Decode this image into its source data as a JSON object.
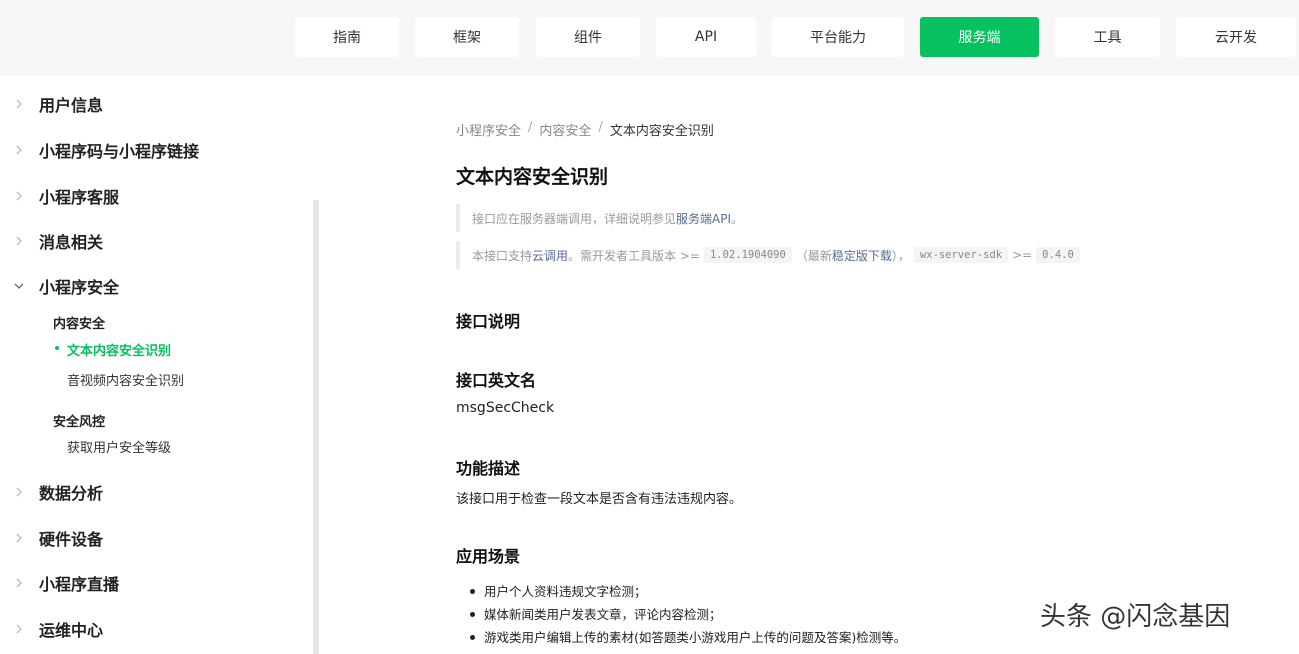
{
  "topnav": {
    "tabs": [
      {
        "label": "指南"
      },
      {
        "label": "框架"
      },
      {
        "label": "组件"
      },
      {
        "label": "API"
      },
      {
        "label": "平台能力"
      },
      {
        "label": "服务端"
      },
      {
        "label": "工具"
      },
      {
        "label": "云开发"
      }
    ],
    "active_index": 5,
    "accent_color": "#07c160"
  },
  "sidebar": {
    "items": [
      {
        "label": "用户信息",
        "expanded": false
      },
      {
        "label": "小程序码与小程序链接",
        "expanded": false
      },
      {
        "label": "小程序客服",
        "expanded": false
      },
      {
        "label": "消息相关",
        "expanded": false
      },
      {
        "label": "小程序安全",
        "expanded": true
      },
      {
        "label": "数据分析",
        "expanded": false
      },
      {
        "label": "硬件设备",
        "expanded": false
      },
      {
        "label": "小程序直播",
        "expanded": false
      },
      {
        "label": "运维中心",
        "expanded": false
      }
    ],
    "security_children": {
      "group1": "内容安全",
      "group1_items": [
        "文本内容安全识别",
        "音视频内容安全识别"
      ],
      "group2": "安全风控",
      "group2_items": [
        "获取用户安全等级"
      ]
    }
  },
  "breadcrumb": {
    "items": [
      "小程序安全",
      "内容安全",
      "文本内容安全识别"
    ],
    "separator": "/"
  },
  "page": {
    "title": "文本内容安全识别",
    "tip1": {
      "text": "接口应在服务器端调用，详细说明参见",
      "link": "服务端API",
      "suffix": "。"
    },
    "tip2": {
      "prefix": "本接口支持",
      "link_cloud": "云调用",
      "mid1": "。需开发者工具版本 >= ",
      "version_tools": "1.02.1904090",
      "mid2": "（最新",
      "link_download": "稳定版下载",
      "mid3": "），",
      "sdk_name": "wx-server-sdk",
      "mid4": " >= ",
      "sdk_version": "0.4.0"
    },
    "sections": {
      "desc_heading": "接口说明",
      "en_name_heading": "接口英文名",
      "en_name": "msgSecCheck",
      "func_heading": "功能描述",
      "func_text": "该接口用于检查一段文本是否含有违法违规内容。",
      "scene_heading": "应用场景",
      "scenes": [
        "用户个人资料违规文字检测；",
        "媒体新闻类用户发表文章，评论内容检测；",
        "游戏类用户编辑上传的素材(如答题类小游戏用户上传的问题及答案)检测等。"
      ]
    }
  },
  "watermark": "头条 @闪念基因"
}
